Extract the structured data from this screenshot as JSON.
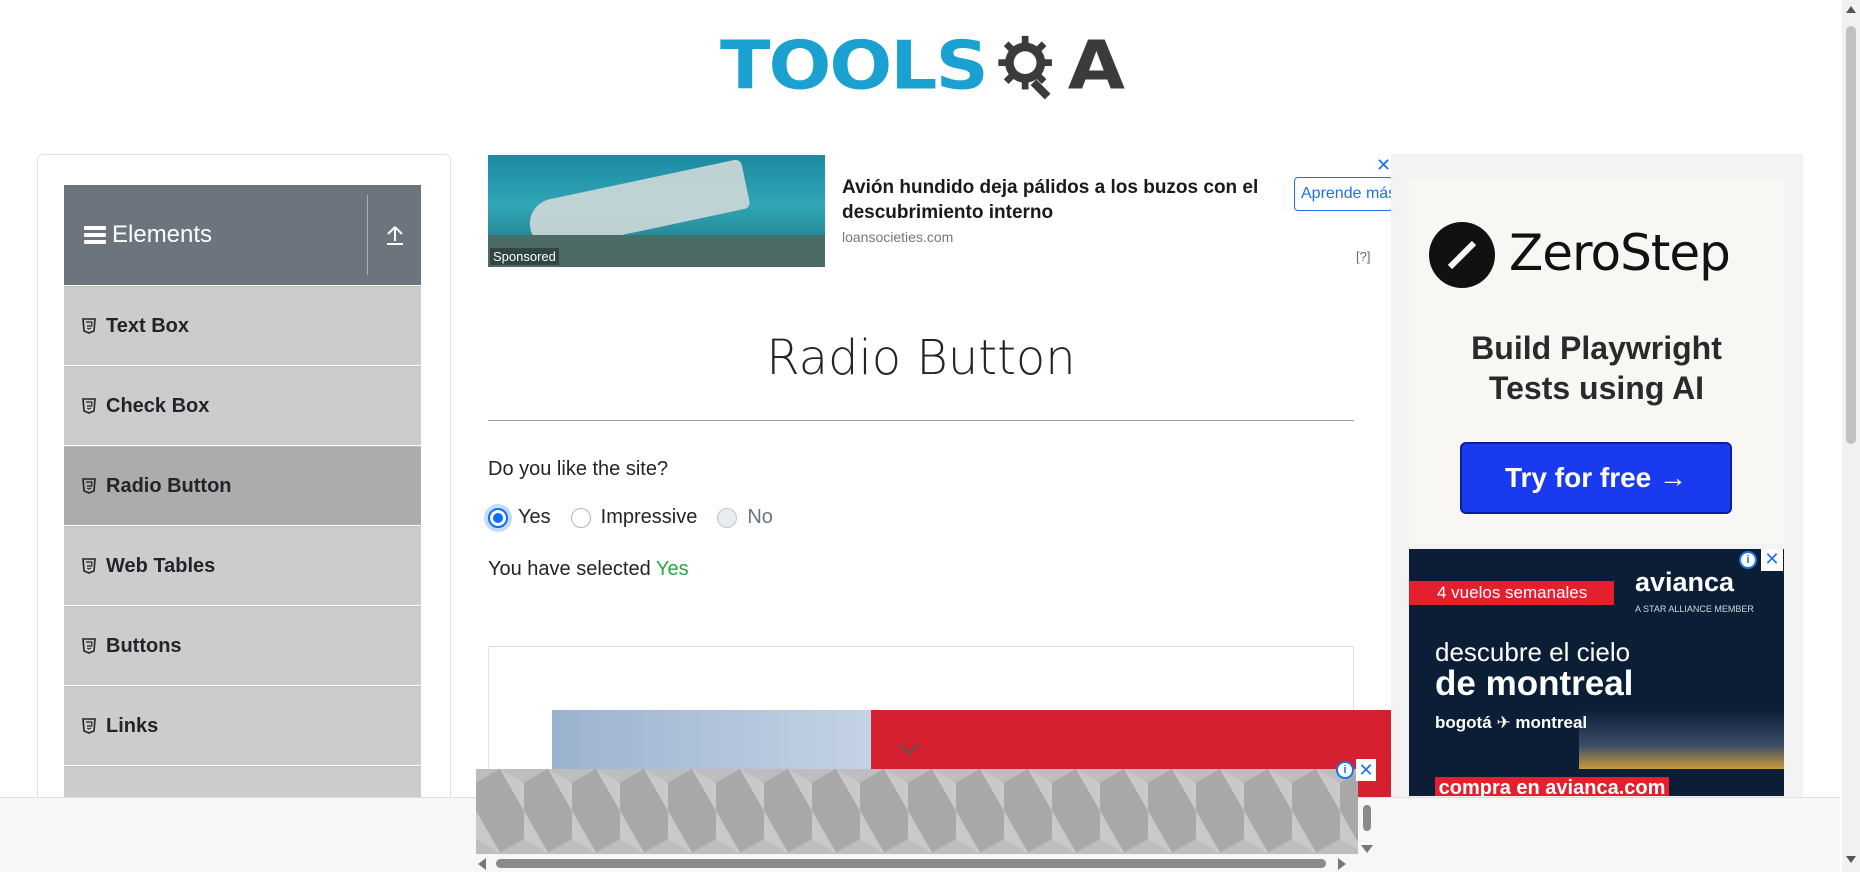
{
  "header": {
    "logo_text_left": "TOOLS",
    "logo_text_right": "A",
    "logo_icon": "gear-magnifier-icon",
    "logo_alt": "TOOLSQA"
  },
  "sidebar": {
    "group_title": "Elements",
    "group_icon": "hamburger-icon",
    "collapse_icon": "upload-arrow-icon",
    "items": [
      {
        "label": "Text Box",
        "icon": "html5-icon",
        "active": false
      },
      {
        "label": "Check Box",
        "icon": "html5-icon",
        "active": false
      },
      {
        "label": "Radio Button",
        "icon": "html5-icon",
        "active": true
      },
      {
        "label": "Web Tables",
        "icon": "html5-icon",
        "active": false
      },
      {
        "label": "Buttons",
        "icon": "html5-icon",
        "active": false
      },
      {
        "label": "Links",
        "icon": "html5-icon",
        "active": false
      }
    ]
  },
  "top_ad": {
    "sponsored_label": "Sponsored",
    "headline": "Avión hundido deja pálidos a los buzos con el descubrimiento interno",
    "domain": "loansocieties.com",
    "cta": "Aprende más",
    "close": "✕",
    "info": "[?]"
  },
  "main": {
    "title": "Radio Button",
    "question": "Do you like the site?",
    "options": [
      {
        "label": "Yes",
        "checked": true,
        "disabled": false
      },
      {
        "label": "Impressive",
        "checked": false,
        "disabled": false
      },
      {
        "label": "No",
        "checked": false,
        "disabled": true
      }
    ],
    "result_prefix": "You have selected",
    "result_value": "Yes"
  },
  "right_ads": {
    "zerostep": {
      "brand": "ZeroStep",
      "tagline_line1": "Build Playwright",
      "tagline_line2": "Tests using AI",
      "cta": "Try for free →"
    },
    "avianca": {
      "badge": "4 vuelos semanales",
      "brand": "avianca",
      "member": "A STAR ALLIANCE MEMBER",
      "headline_1": "descubre el cielo",
      "headline_2": "de montreal",
      "route": "bogotá ✈ montreal",
      "cta": "compra en avianca.com",
      "close": "✕",
      "info": "i"
    }
  },
  "anchor_ad": {
    "close": "✕",
    "info": "i"
  },
  "colors": {
    "brand_blue": "#1aa0d1",
    "sidebar_header": "#6c757d",
    "menu_item": "#cccccc",
    "menu_item_active": "#acacac",
    "radio_checked": "#0d6efd",
    "result_green": "#28a745"
  }
}
